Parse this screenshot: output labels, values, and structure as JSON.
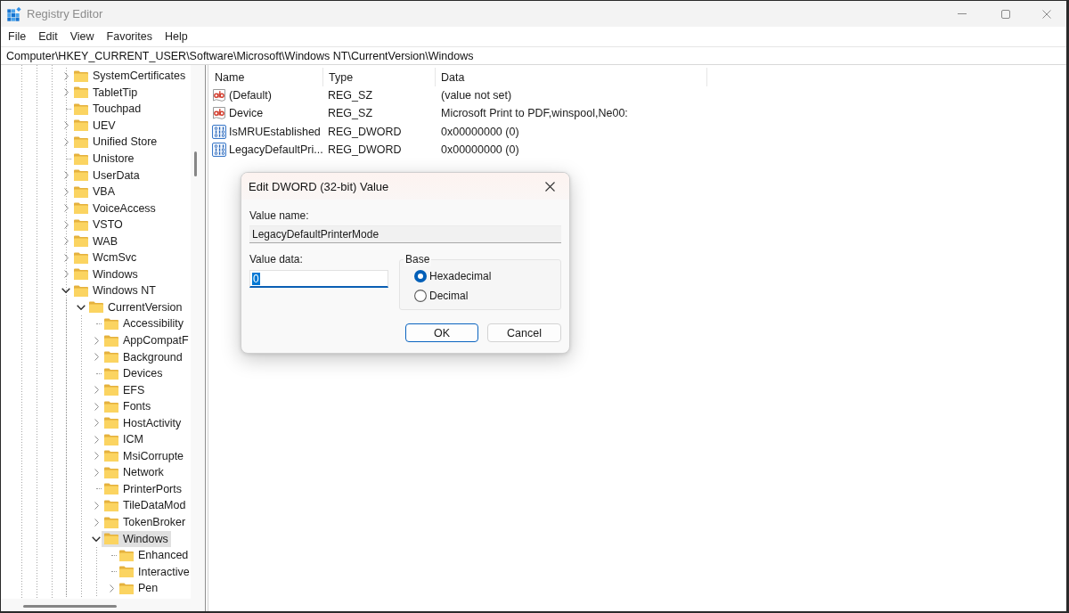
{
  "window": {
    "title": "Registry Editor",
    "active": false
  },
  "menu": [
    "File",
    "Edit",
    "View",
    "Favorites",
    "Help"
  ],
  "address_bar": {
    "path": "Computer\\HKEY_CURRENT_USER\\Software\\Microsoft\\Windows NT\\CurrentVersion\\Windows"
  },
  "tree": {
    "items": [
      {
        "label": "SystemCertificates",
        "has_subkeys": true,
        "expanded": false,
        "selected": false
      },
      {
        "label": "TabletTip",
        "has_subkeys": true,
        "expanded": false,
        "selected": false
      },
      {
        "label": "Touchpad",
        "has_subkeys": false,
        "selected": false
      },
      {
        "label": "UEV",
        "has_subkeys": true,
        "expanded": false,
        "selected": false
      },
      {
        "label": "Unified Store",
        "has_subkeys": true,
        "expanded": false,
        "selected": false
      },
      {
        "label": "Unistore",
        "has_subkeys": false,
        "selected": false
      },
      {
        "label": "UserData",
        "has_subkeys": true,
        "expanded": false,
        "selected": false
      },
      {
        "label": "VBA",
        "has_subkeys": true,
        "expanded": false,
        "selected": false
      },
      {
        "label": "VoiceAccess",
        "has_subkeys": true,
        "expanded": false,
        "selected": false
      },
      {
        "label": "VSTO",
        "has_subkeys": true,
        "expanded": false,
        "selected": false
      },
      {
        "label": "WAB",
        "has_subkeys": true,
        "expanded": false,
        "selected": false
      },
      {
        "label": "WcmSvc",
        "has_subkeys": true,
        "expanded": false,
        "selected": false
      },
      {
        "label": "Windows",
        "has_subkeys": true,
        "expanded": false,
        "selected": false
      },
      {
        "label": "Windows NT",
        "has_subkeys": true,
        "expanded": true,
        "selected": false,
        "children": [
          {
            "label": "CurrentVersion",
            "has_subkeys": true,
            "expanded": true,
            "selected": false,
            "children": [
              {
                "label": "Accessibility",
                "has_subkeys": false,
                "selected": false
              },
              {
                "label": "AppCompatF",
                "has_subkeys": true,
                "expanded": false,
                "selected": false
              },
              {
                "label": "Background",
                "has_subkeys": true,
                "expanded": false,
                "selected": false
              },
              {
                "label": "Devices",
                "has_subkeys": false,
                "selected": false
              },
              {
                "label": "EFS",
                "has_subkeys": true,
                "expanded": false,
                "selected": false
              },
              {
                "label": "Fonts",
                "has_subkeys": true,
                "expanded": false,
                "selected": false
              },
              {
                "label": "HostActivity",
                "has_subkeys": true,
                "expanded": false,
                "selected": false
              },
              {
                "label": "ICM",
                "has_subkeys": true,
                "expanded": false,
                "selected": false
              },
              {
                "label": "MsiCorrupte",
                "has_subkeys": true,
                "expanded": false,
                "selected": false
              },
              {
                "label": "Network",
                "has_subkeys": true,
                "expanded": false,
                "selected": false
              },
              {
                "label": "PrinterPorts",
                "has_subkeys": false,
                "selected": false
              },
              {
                "label": "TileDataMod",
                "has_subkeys": true,
                "expanded": false,
                "selected": false
              },
              {
                "label": "TokenBroker",
                "has_subkeys": true,
                "expanded": false,
                "selected": false
              },
              {
                "label": "Windows",
                "has_subkeys": true,
                "expanded": true,
                "selected": true,
                "children": [
                  {
                    "label": "Enhanced",
                    "has_subkeys": false,
                    "selected": false
                  },
                  {
                    "label": "Interactive",
                    "has_subkeys": false,
                    "selected": false
                  },
                  {
                    "label": "Pen",
                    "has_subkeys": true,
                    "expanded": false,
                    "selected": false
                  }
                ]
              }
            ]
          }
        ]
      }
    ]
  },
  "values": {
    "columns": [
      "Name",
      "Type",
      "Data"
    ],
    "rows": [
      {
        "kind": "string",
        "name": "(Default)",
        "type": "REG_SZ",
        "data": "(value not set)",
        "selected": false
      },
      {
        "kind": "string",
        "name": "Device",
        "type": "REG_SZ",
        "data": "Microsoft Print to PDF,winspool,Ne00:",
        "selected": false
      },
      {
        "kind": "dword",
        "name": "IsMRUEstablished",
        "type": "REG_DWORD",
        "data": "0x00000000 (0)",
        "selected": false
      },
      {
        "kind": "dword",
        "name": "LegacyDefaultPri...",
        "type": "REG_DWORD",
        "data": "0x00000000 (0)",
        "selected": false
      }
    ]
  },
  "dialog": {
    "title": "Edit DWORD (32-bit) Value",
    "value_name_label": "Value name:",
    "value_name": "LegacyDefaultPrinterMode",
    "value_data_label": "Value data:",
    "value_data": "0",
    "value_data_selected": true,
    "base": {
      "label": "Base",
      "options": [
        {
          "label": "Hexadecimal",
          "selected": true
        },
        {
          "label": "Decimal",
          "selected": false
        }
      ]
    },
    "buttons": [
      {
        "label": "OK",
        "is_default": true
      },
      {
        "label": "Cancel",
        "is_default": false
      }
    ]
  }
}
